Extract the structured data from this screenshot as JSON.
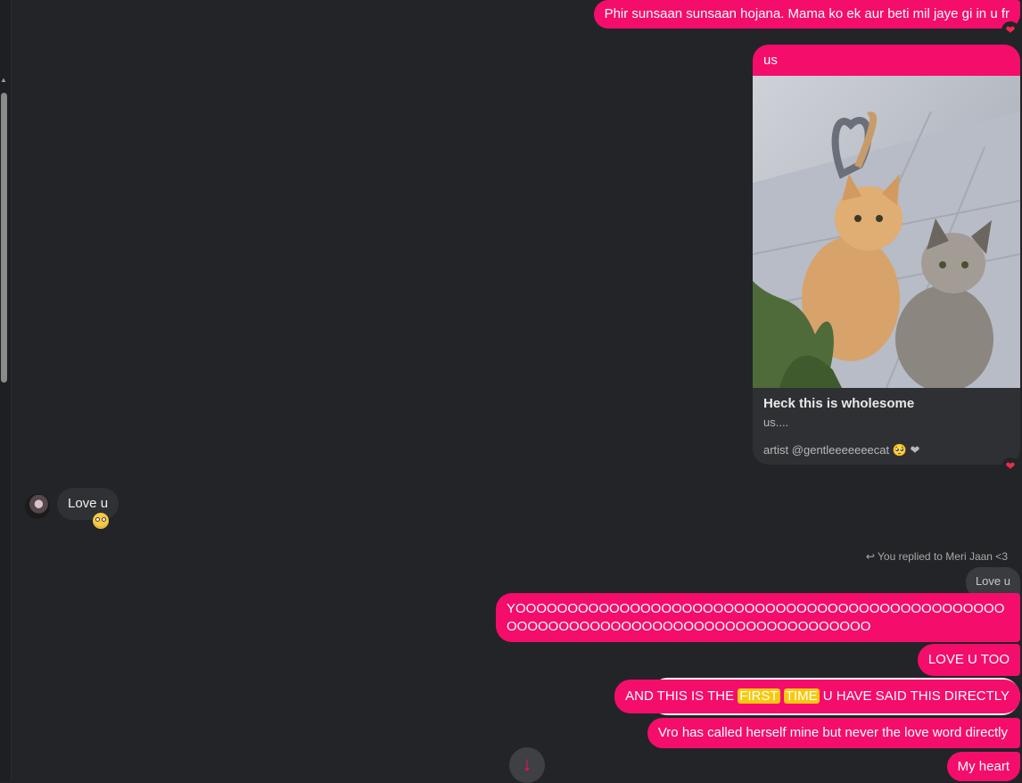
{
  "messages": {
    "m1": "Phir sunsaan sunsaan hojana. Mama ko ek aur beti mil jaye gi in u fr",
    "m1_reaction": "❤",
    "card": {
      "caption": "us",
      "title": "Heck this is wholesome",
      "subtitle": "us....",
      "artist": "artist @gentleeeeeeecat 🥺 ❤",
      "reaction": "❤"
    },
    "incoming": {
      "text": "Love u",
      "reaction_icon": "flushed-face-emoji"
    },
    "reply_meta": "You replied to Meri Jaan <3",
    "quoted_text": "Love u",
    "yo": "YOOOOOOOOOOOOOOOOOOOOOOOOOOOOOOOOOOOOOOOOOOOOOOOOOOOOOOOOOOOOOOOOOOOOOOOOOOOOOOOOOO",
    "love_too": "LOVE U TOO",
    "and_this": {
      "part1": "AND THIS IS THE ",
      "hl1": "FIRST",
      "hl2": "TIME",
      "part2": " U HAVE SAID THIS DIRECTLY"
    },
    "vro": "Vro has called herself mine but never the love word directly",
    "my_heart": "My heart"
  },
  "colors": {
    "outgoing": "#f50d6c",
    "background": "#232427",
    "incoming": "#303135",
    "highlight": "#f6c90e"
  }
}
